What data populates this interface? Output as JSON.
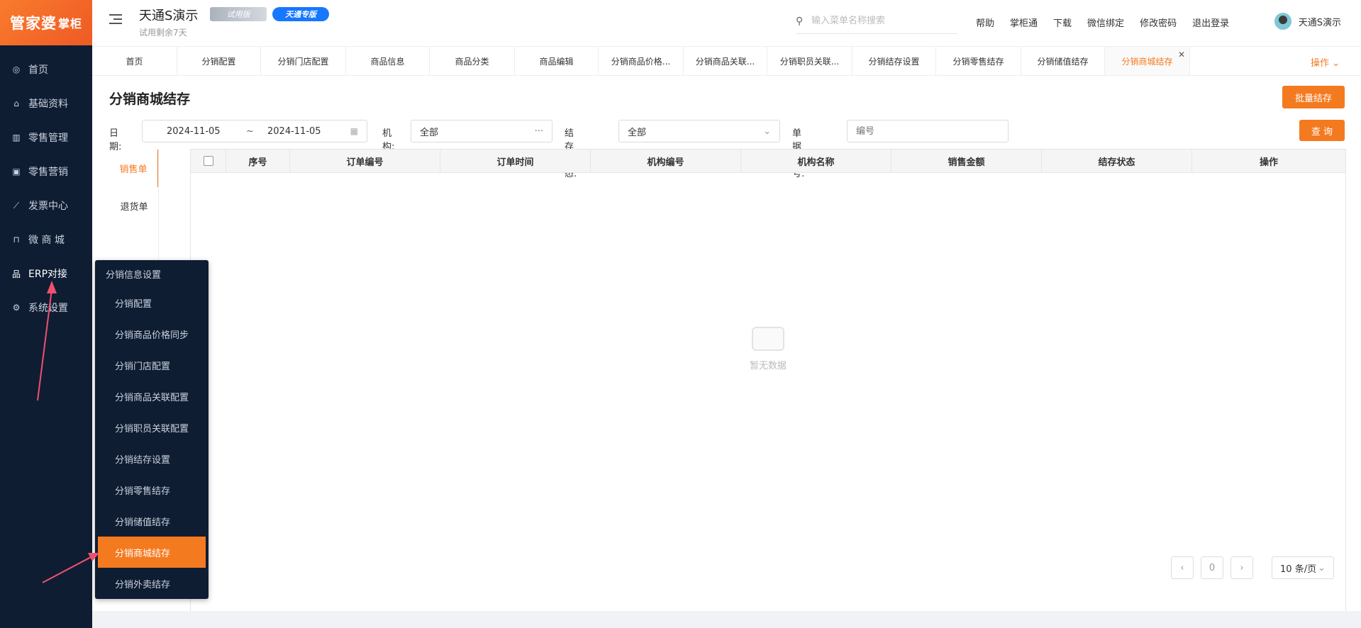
{
  "sidebar": {
    "logo": {
      "main": "管家婆",
      "sub": "掌柜"
    },
    "items": [
      {
        "label": "首页",
        "icon": "globe-icon"
      },
      {
        "label": "基础资料",
        "icon": "home-icon"
      },
      {
        "label": "零售管理",
        "icon": "chart-icon"
      },
      {
        "label": "零售营销",
        "icon": "gift-icon"
      },
      {
        "label": "发票中心",
        "icon": "trend-icon"
      },
      {
        "label": "微 商 城",
        "icon": "bag-icon"
      },
      {
        "label": "ERP对接",
        "icon": "network-icon"
      },
      {
        "label": "系统设置",
        "icon": "gear-icon"
      }
    ]
  },
  "header": {
    "app_title": "天通S演示",
    "trial_note": "试用剩余7天",
    "badge_trial": "试用版",
    "badge_pro": "天通专版",
    "search_placeholder": "输入菜单名称搜索",
    "links": [
      "帮助",
      "掌柜通",
      "下载",
      "微信绑定",
      "修改密码",
      "退出登录"
    ],
    "user_name": "天通S演示"
  },
  "tabs": {
    "items": [
      "首页",
      "分销配置",
      "分销门店配置",
      "商品信息",
      "商品分类",
      "商品编辑",
      "分销商品价格...",
      "分销商品关联...",
      "分销职员关联...",
      "分销结存设置",
      "分销零售结存",
      "分销储值结存",
      "分销商城结存"
    ],
    "active_index": 12,
    "ops_label": "操作"
  },
  "page": {
    "title": "分销商城结存",
    "batch_button": "批量结存",
    "query_button": "查 询",
    "filters": {
      "date_label": "日期:",
      "date_start": "2024-11-05",
      "date_sep": "~",
      "date_end": "2024-11-05",
      "org_label": "机构:",
      "org_value": "全部",
      "status_label": "结存状态:",
      "status_value": "全部",
      "doc_label": "单据编号:",
      "doc_placeholder": "编号"
    },
    "side_tabs": [
      "销售单",
      "退货单"
    ],
    "table_headers": [
      "序号",
      "订单编号",
      "订单时间",
      "机构编号",
      "机构名称",
      "销售金额",
      "结存状态",
      "操作"
    ],
    "empty_text": "暂无数据",
    "pager": {
      "prev": "‹",
      "page": "0",
      "next": "›",
      "size": "10 条/页"
    }
  },
  "popup": {
    "title": "分销信息设置",
    "items": [
      "分销配置",
      "分销商品价格同步",
      "分销门店配置",
      "分销商品关联配置",
      "分销职员关联配置",
      "分销结存设置",
      "分销零售结存",
      "分销储值结存",
      "分销商城结存",
      "分销外卖结存"
    ],
    "active_index": 8
  },
  "colors": {
    "accent": "#f47a20",
    "sidebar": "#0f1d33",
    "arrow": "#f0506e"
  }
}
